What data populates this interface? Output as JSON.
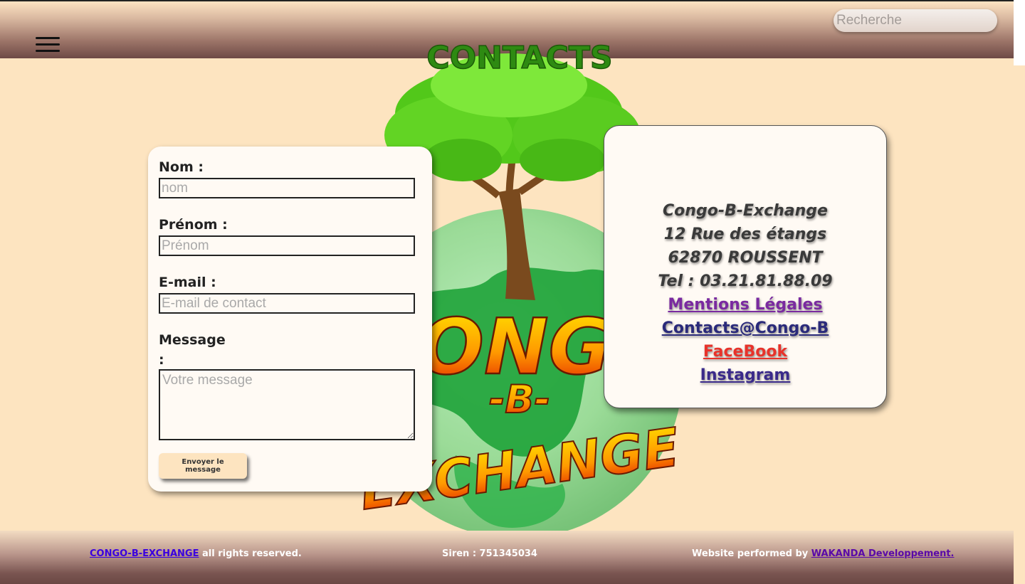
{
  "header": {
    "search_placeholder": "Recherche"
  },
  "logo": {
    "heading": "CONTACTS",
    "line1": "CONGO",
    "line2": "-B-",
    "line3": "EXCHANGE"
  },
  "form": {
    "nom_label": "Nom :",
    "nom_placeholder": "nom",
    "prenom_label": "Prénom :",
    "prenom_placeholder": "Prénom",
    "email_label": "E-mail :",
    "email_placeholder": "E-mail de contact",
    "message_label_1": "Message",
    "message_label_2": ":",
    "message_placeholder": "Votre message",
    "submit_label": "Envoyer le message"
  },
  "info": {
    "company": "Congo-B-Exchange",
    "street": "12 Rue des étangs",
    "city": "62870 ROUSSENT",
    "phone": "Tel : 03.21.81.88.09",
    "legal_link": "Mentions Légales",
    "email_link": "Contacts@Congo-B",
    "facebook_link": "FaceBook",
    "instagram_link": "Instagram",
    "colors": {
      "legal": "#7a2aa0",
      "email": "#2a2a7a",
      "facebook": "#e8322a",
      "instagram": "#3a2a8a"
    }
  },
  "footer": {
    "brand_link": "CONGO-B-EXCHANGE",
    "rights": " all rights reserved.",
    "siren": "Siren : 751345034",
    "performed_by": "Website performed by ",
    "developer_link": "WAKANDA Developpement."
  }
}
